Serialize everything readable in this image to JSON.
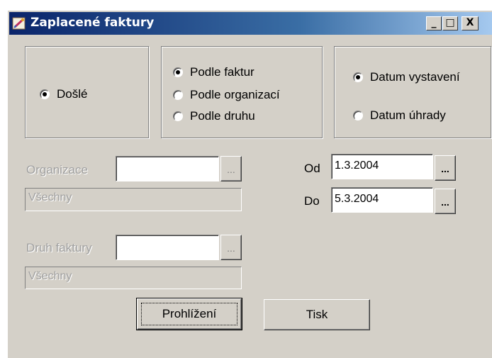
{
  "window": {
    "title": "Zaplacené faktury",
    "minimize": "_",
    "maximize": "□",
    "close": "X"
  },
  "type_group": {
    "options": [
      {
        "label": "Došlé",
        "checked": true
      }
    ]
  },
  "sort_group": {
    "options": [
      {
        "label": "Podle faktur",
        "checked": true
      },
      {
        "label": "Podle organizací",
        "checked": false
      },
      {
        "label": "Podle druhu",
        "checked": false
      }
    ]
  },
  "date_type_group": {
    "options": [
      {
        "label": "Datum vystavení",
        "checked": true
      },
      {
        "label": "Datum úhrady",
        "checked": false
      }
    ]
  },
  "organization": {
    "label": "Organizace",
    "value": "",
    "browse": "...",
    "selection": "Všechny"
  },
  "invoice_type": {
    "label": "Druh faktury",
    "value": "",
    "browse": "...",
    "selection": "Všechny"
  },
  "date_from": {
    "label": "Od",
    "value": "1.3.2004",
    "browse": "..."
  },
  "date_to": {
    "label": "Do",
    "value": "5.3.2004",
    "browse": "..."
  },
  "buttons": {
    "preview": "Prohlížení",
    "print": "Tisk"
  },
  "colors": {
    "face": "#d4d0c8",
    "title_start": "#0a246a",
    "title_end": "#a6caf0",
    "disabled_text": "#a0a0a0"
  }
}
